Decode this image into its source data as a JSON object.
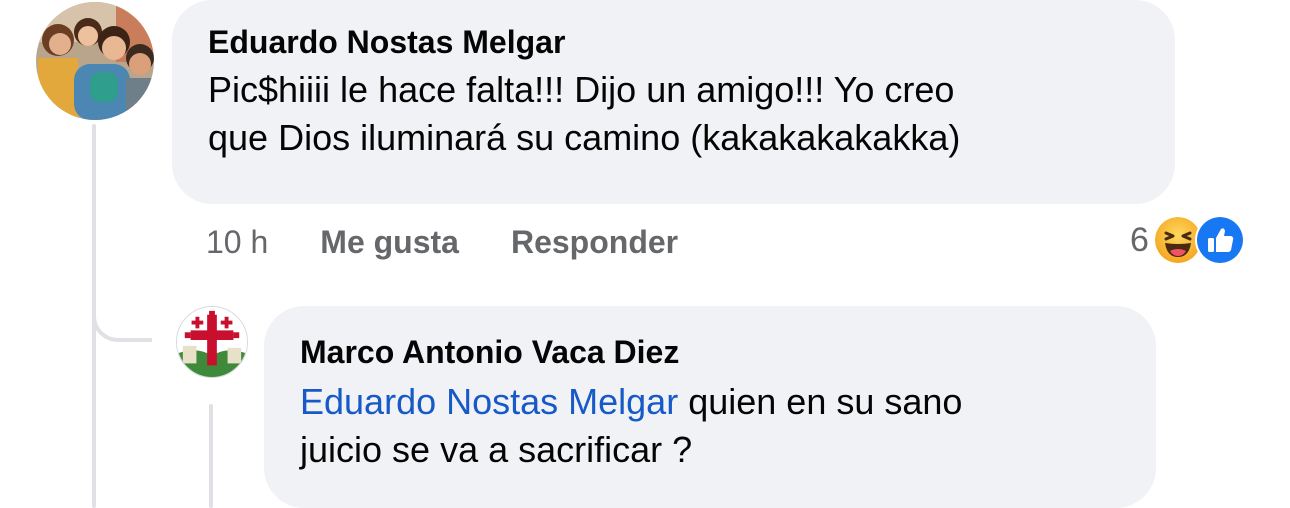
{
  "comments": [
    {
      "author": "Eduardo Nostas Melgar",
      "text_line1": "Pic$hiiii le hace falta!!! Dijo un amigo!!! Yo creo",
      "text_line2": "que Dios iluminará su camino (kakakakakakka)",
      "time": "10 h",
      "like_label": "Me gusta",
      "reply_label": "Responder",
      "reaction_count": "6",
      "reactions": [
        "haha-icon",
        "like-icon"
      ]
    },
    {
      "author": "Marco Antonio Vaca Diez",
      "mention": "Eduardo Nostas Melgar",
      "text_line1_rest": " quien en su sano",
      "text_line2": "juicio se va a sacrificar ?"
    }
  ],
  "colors": {
    "bubble": "#f0f2f5",
    "mention": "#1659c7",
    "secondary_text": "#65676b",
    "like_blue": "#1877f2",
    "haha_yellow": "#f7b125"
  }
}
